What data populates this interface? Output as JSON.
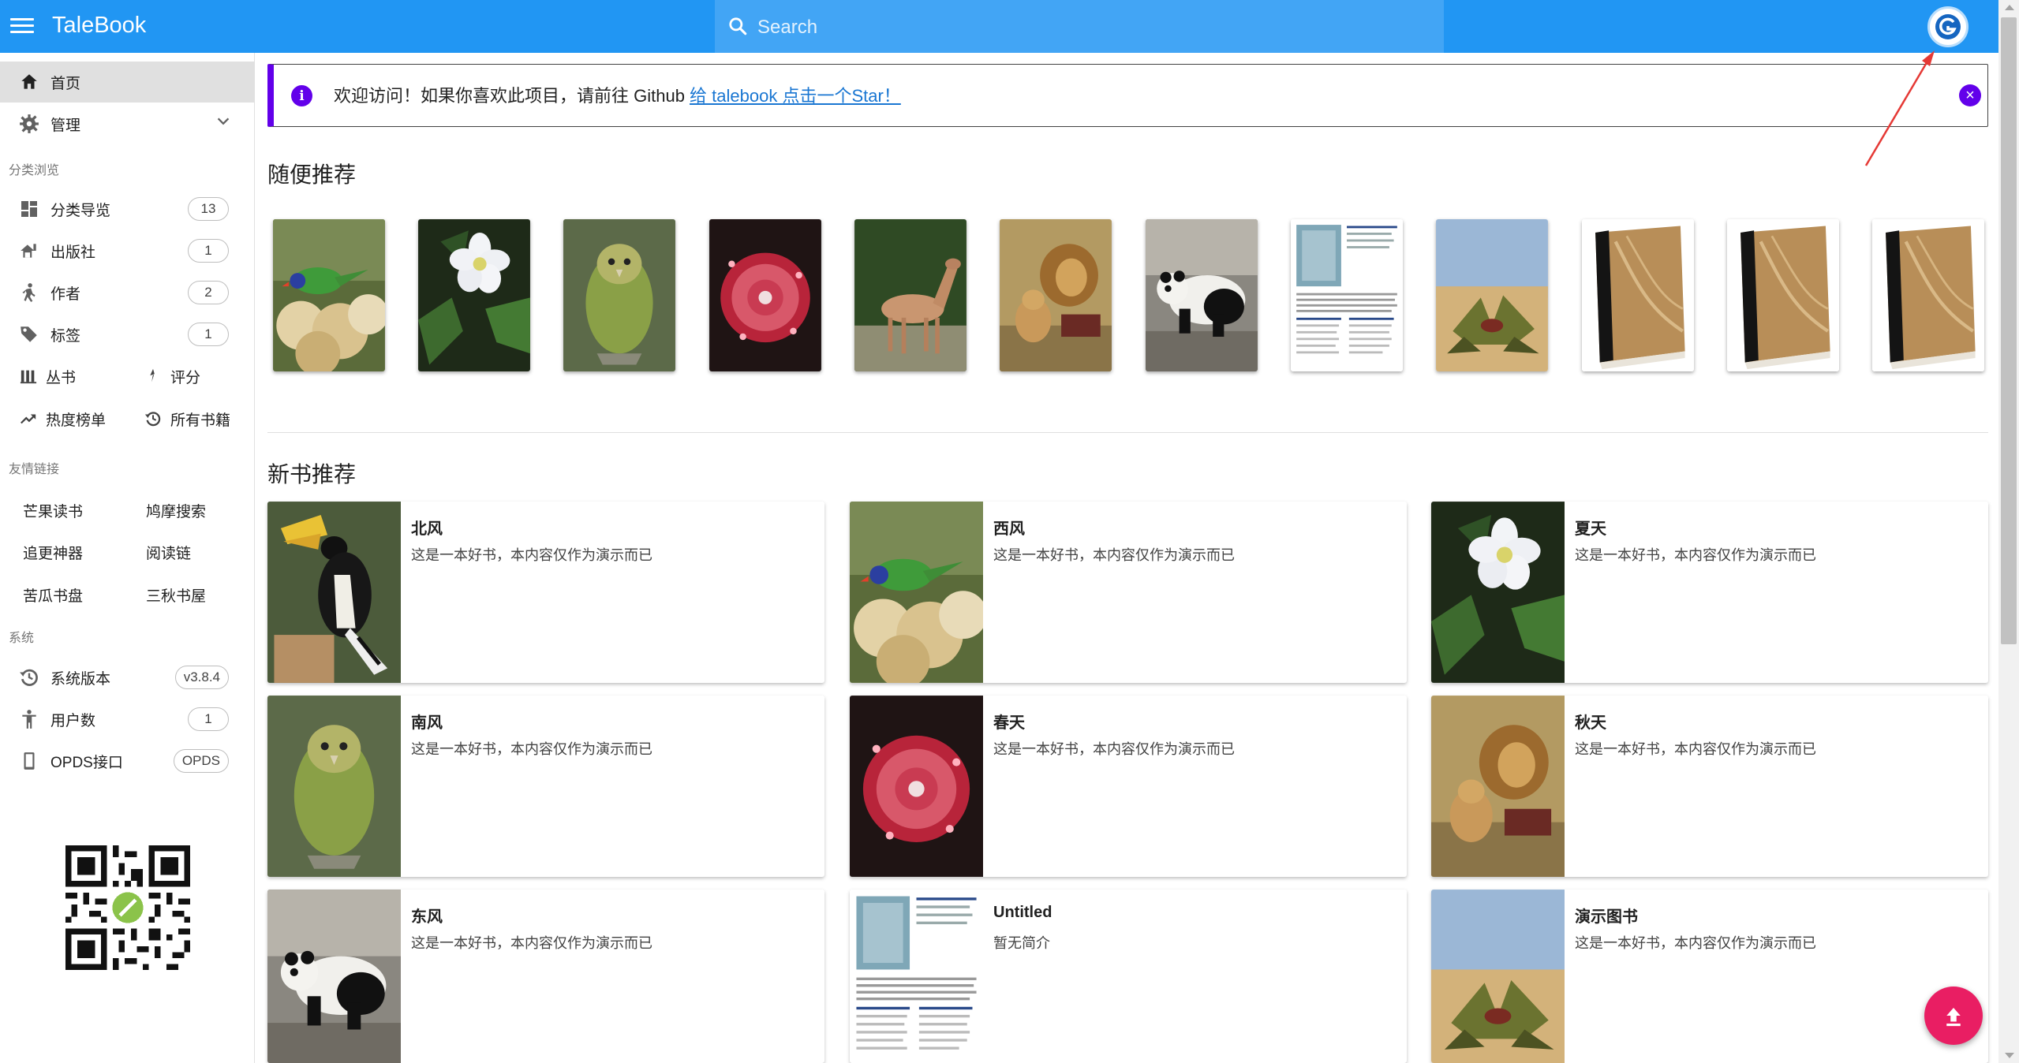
{
  "app": {
    "title": "TaleBook",
    "search_placeholder": "Search"
  },
  "sidebar": {
    "home": "首页",
    "admin": "管理",
    "browse_header": "分类浏览",
    "categories": {
      "label": "分类导览",
      "count": "13"
    },
    "publishers": {
      "label": "出版社",
      "count": "1"
    },
    "authors": {
      "label": "作者",
      "count": "2"
    },
    "tags": {
      "label": "标签",
      "count": "1"
    },
    "series": "丛书",
    "rating": "评分",
    "hot": "热度榜单",
    "all_books": "所有书籍",
    "links_header": "友情链接",
    "links": [
      "芒果读书",
      "鸠摩搜索",
      "追更神器",
      "阅读链",
      "苦瓜书盘",
      "三秋书屋"
    ],
    "system_header": "系统",
    "version": {
      "label": "系统版本",
      "value": "v3.8.4"
    },
    "users": {
      "label": "用户数",
      "value": "1"
    },
    "opds": {
      "label": "OPDS接口",
      "value": "OPDS"
    }
  },
  "alert": {
    "text": "欢迎访问！如果你喜欢此项目，请前往 Github ",
    "link": "给 talebook 点击一个Star！"
  },
  "random": {
    "title": "随便推荐",
    "covers": [
      "lorikeet",
      "white-flower",
      "kakapo",
      "sundew",
      "deer",
      "lions",
      "panda",
      "document",
      "welwitschia",
      "default-book",
      "default-book",
      "default-book"
    ]
  },
  "new_books": {
    "title": "新书推荐",
    "items": [
      {
        "title": "北风",
        "desc": "这是一本好书，本内容仅作为演示而已"
      },
      {
        "title": "西风",
        "desc": "这是一本好书，本内容仅作为演示而已"
      },
      {
        "title": "夏天",
        "desc": "这是一本好书，本内容仅作为演示而已"
      },
      {
        "title": "南风",
        "desc": "这是一本好书，本内容仅作为演示而已"
      },
      {
        "title": "春天",
        "desc": "这是一本好书，本内容仅作为演示而已"
      },
      {
        "title": "秋天",
        "desc": "这是一本好书，本内容仅作为演示而已"
      },
      {
        "title": "东风",
        "desc": "这是一本好书，本内容仅作为演示而已"
      },
      {
        "title": "Untitled",
        "desc": "暂无简介"
      },
      {
        "title": "演示图书",
        "desc": "这是一本好书，本内容仅作为演示而已"
      }
    ]
  },
  "colors": {
    "appbar": "#2196f3",
    "search": "#42a5f5",
    "alert_accent": "#6200ea",
    "fab": "#e91e63",
    "link": "#1976d2"
  }
}
